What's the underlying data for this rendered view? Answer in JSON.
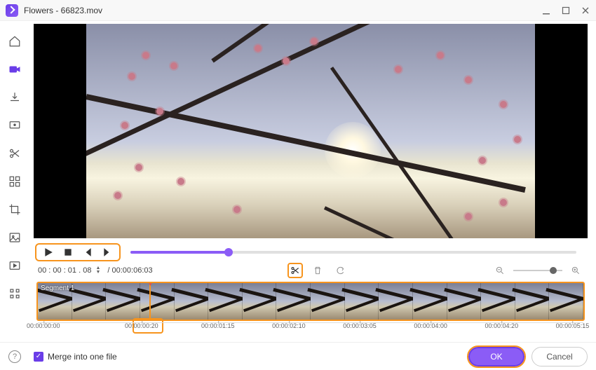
{
  "window": {
    "title": "Flowers - 66823.mov"
  },
  "playback": {
    "current_time": "00 : 00 : 01 . 08",
    "duration": "/ 00:00:06:03"
  },
  "timeline": {
    "segment_label": "Segment 1",
    "ticks": [
      "00:00:00:00",
      "00:00:00:20",
      "00:00:01:15",
      "00:00:02:10",
      "00:00:03:05",
      "00:00:04:00",
      "00:00:04:20",
      "00:00:05:15"
    ]
  },
  "footer": {
    "merge_label": "Merge into one file",
    "ok": "OK",
    "cancel": "Cancel"
  }
}
